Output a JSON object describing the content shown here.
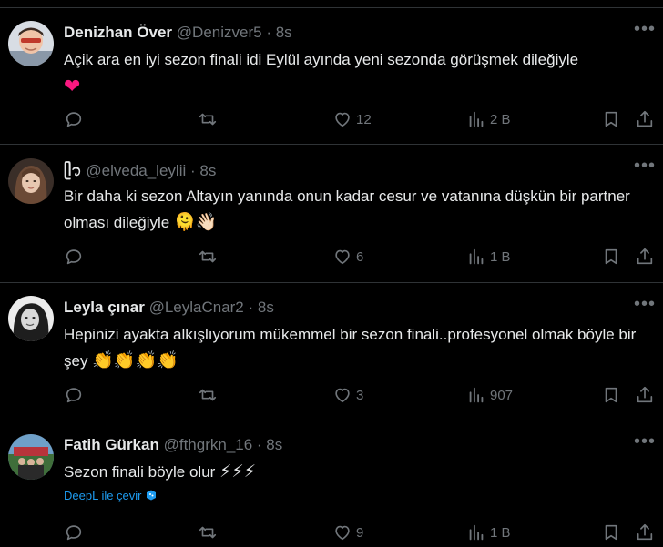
{
  "tweets": [
    {
      "name": "Denizhan Över",
      "handle": "@Denizver5",
      "time": "· 8s",
      "text": "Açik ara en iyi sezon finali idi Eylül ayında yeni sezonda görüşmek dileğiyle",
      "emoji": "❤",
      "likes": "12",
      "views": "2 B"
    },
    {
      "name": "ᥫ᭡",
      "handle": "@elveda_leylii",
      "time": "· 8s",
      "text": "Bir daha ki sezon Altayın yanında onun kadar cesur ve vatanına düşkün bir partner olması dileğiyle",
      "emoji": "🫠👋🏻",
      "likes": "6",
      "views": "1 B"
    },
    {
      "name": "Leyla çınar",
      "handle": "@LeylaCnar2",
      "time": "· 8s",
      "text": "Hepinizi ayakta alkışlıyorum mükemmel bir sezon finali..profesyonel olmak böyle bir şey",
      "emoji": "👏👏👏👏",
      "likes": "3",
      "views": "907"
    },
    {
      "name": "Fatih Gürkan",
      "handle": "@fthgrkn_16",
      "time": "· 8s",
      "text": "Sezon finali böyle olur",
      "emoji": "⚡⚡⚡",
      "translate": "DeepL ile çevir",
      "likes": "9",
      "views": "1 B"
    }
  ],
  "icons": {
    "reply": "reply-icon",
    "retweet": "retweet-icon",
    "like": "like-icon",
    "views": "views-icon",
    "bookmark": "bookmark-icon",
    "share": "share-icon",
    "more": "more-icon"
  },
  "colors": {
    "background": "#000000",
    "text": "#e7e9ea",
    "muted": "#71767b",
    "divider": "#2f3336",
    "link": "#1d9bf0",
    "heart": "#f91880"
  }
}
